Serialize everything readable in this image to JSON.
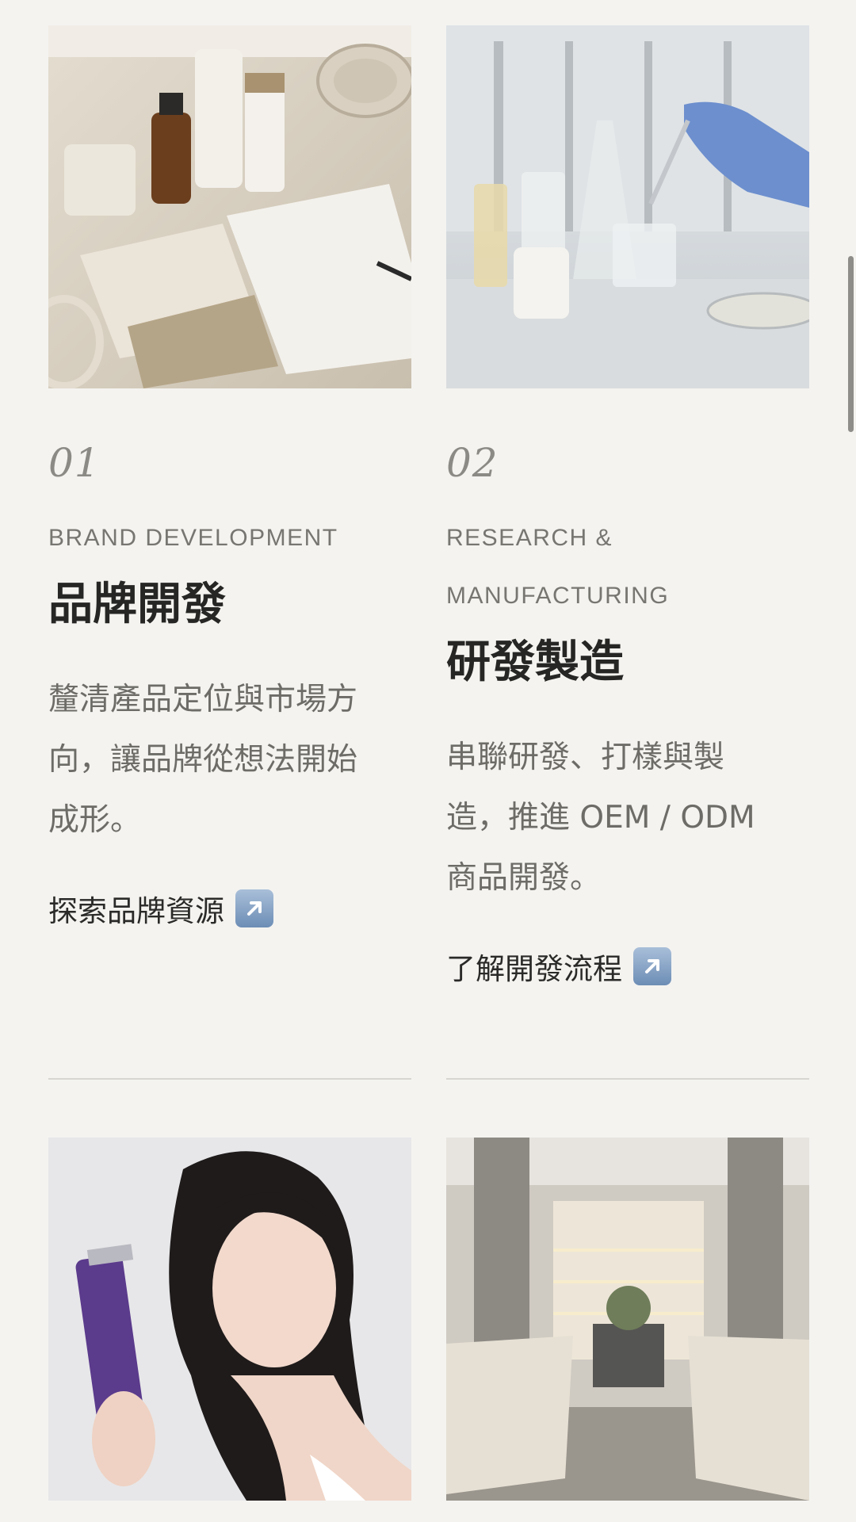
{
  "cards": [
    {
      "number": "01",
      "subtitle_en": "BRAND DEVELOPMENT",
      "title_zh": "品牌開發",
      "description_lines": [
        "釐清產品定位與市場方",
        "向，讓品牌從想法開始",
        "成形。"
      ],
      "link_label": "探索品牌資源",
      "link_icon": "north-east-arrow-icon"
    },
    {
      "number": "02",
      "subtitle_en_lines": [
        "RESEARCH &",
        "MANUFACTURING"
      ],
      "title_zh": "研發製造",
      "description_lines": [
        "串聯研發、打樣與製",
        "造，推進 OEM / ODM",
        "商品開發。"
      ],
      "link_label": "了解開發流程",
      "link_icon": "north-east-arrow-icon"
    }
  ],
  "colors": {
    "background": "#f4f3f0",
    "accent_icon": "#6c8db5",
    "divider": "#d8d6d0"
  }
}
